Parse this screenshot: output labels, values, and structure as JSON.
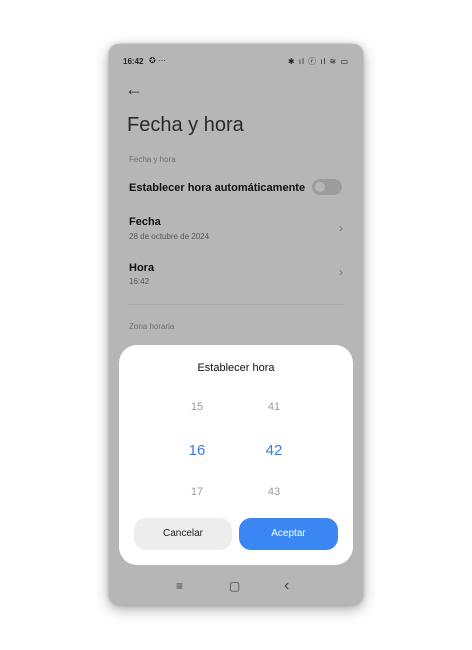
{
  "status_bar": {
    "time": "16:42",
    "left_icons": "✪ ···",
    "right_icons": "✱ ıl ⓡ ıl ≋ ▭"
  },
  "header": {
    "back_icon": "arrow-left",
    "title": "Fecha y hora"
  },
  "sections": {
    "date_time_label": "Fecha y hora",
    "auto_time_label": "Establecer hora automáticamente",
    "auto_time_enabled": false,
    "date_title": "Fecha",
    "date_value": "28 de octubre de 2024",
    "time_title": "Hora",
    "time_value": "16:42",
    "timezone_label": "Zona horaria"
  },
  "dialog": {
    "title": "Establecer hora",
    "hours": [
      "15",
      "16",
      "17"
    ],
    "minutes": [
      "41",
      "42",
      "43"
    ],
    "selected_hour": "16",
    "selected_minute": "42",
    "cancel_label": "Cancelar",
    "accept_label": "Aceptar",
    "accent_color": "#3a86f2"
  },
  "nav_bar": {
    "menu_icon": "≡",
    "home_icon": "▢",
    "back_icon": "‹"
  }
}
